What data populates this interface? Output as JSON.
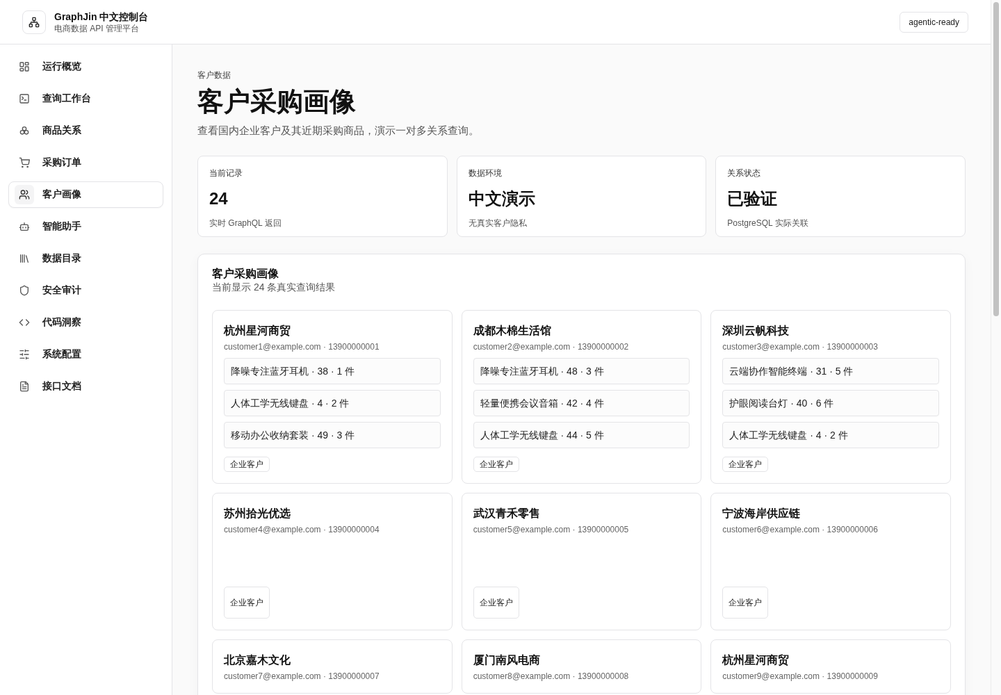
{
  "header": {
    "title": "GraphJin 中文控制台",
    "subtitle": "电商数据 API 管理平台",
    "badge": "agentic-ready"
  },
  "sidebar": {
    "items": [
      {
        "label": "运行概览",
        "selected": false
      },
      {
        "label": "查询工作台",
        "selected": false
      },
      {
        "label": "商品关系",
        "selected": false
      },
      {
        "label": "采购订单",
        "selected": false
      },
      {
        "label": "客户画像",
        "selected": true
      },
      {
        "label": "智能助手",
        "selected": false
      },
      {
        "label": "数据目录",
        "selected": false
      },
      {
        "label": "安全审计",
        "selected": false
      },
      {
        "label": "代码洞察",
        "selected": false
      },
      {
        "label": "系统配置",
        "selected": false
      },
      {
        "label": "接口文档",
        "selected": false
      }
    ]
  },
  "page": {
    "eyebrow": "客户数据",
    "title": "客户采购画像",
    "description": "查看国内企业客户及其近期采购商品，演示一对多关系查询。"
  },
  "stats": [
    {
      "label": "当前记录",
      "value": "24",
      "note": "实时 GraphQL 返回"
    },
    {
      "label": "数据环境",
      "value": "中文演示",
      "note": "无真实客户隐私"
    },
    {
      "label": "关系状态",
      "value": "已验证",
      "note": "PostgreSQL 实际关联"
    }
  ],
  "panel": {
    "title": "客户采购画像",
    "subtitle": "当前显示 24 条真实查询结果",
    "customers": [
      {
        "name": "杭州星河商贸",
        "contact": "customer1@example.com · 13900000001",
        "purchases": [
          "降噪专注蓝牙耳机 · 38 · 1 件",
          "人体工学无线键盘 · 4 · 2 件",
          "移动办公收纳套装 · 49 · 3 件"
        ],
        "tag": "企业客户"
      },
      {
        "name": "成都木棉生活馆",
        "contact": "customer2@example.com · 13900000002",
        "purchases": [
          "降噪专注蓝牙耳机 · 48 · 3 件",
          "轻量便携会议音箱 · 42 · 4 件",
          "人体工学无线键盘 · 44 · 5 件"
        ],
        "tag": "企业客户"
      },
      {
        "name": "深圳云帆科技",
        "contact": "customer3@example.com · 13900000003",
        "purchases": [
          "云端协作智能终端 · 31 · 5 件",
          "护眼阅读台灯 · 40 · 6 件",
          "人体工学无线键盘 · 4 · 2 件"
        ],
        "tag": "企业客户"
      },
      {
        "name": "苏州拾光优选",
        "contact": "customer4@example.com · 13900000004",
        "tag": "企业客户"
      },
      {
        "name": "武汉青禾零售",
        "contact": "customer5@example.com · 13900000005",
        "tag": "企业客户"
      },
      {
        "name": "宁波海岸供应链",
        "contact": "customer6@example.com · 13900000006",
        "tag": "企业客户"
      },
      {
        "name": "北京嘉木文化",
        "contact": "customer7@example.com · 13900000007"
      },
      {
        "name": "厦门南风电商",
        "contact": "customer8@example.com · 13900000008"
      },
      {
        "name": "杭州星河商贸",
        "contact": "customer9@example.com · 13900000009"
      }
    ]
  }
}
